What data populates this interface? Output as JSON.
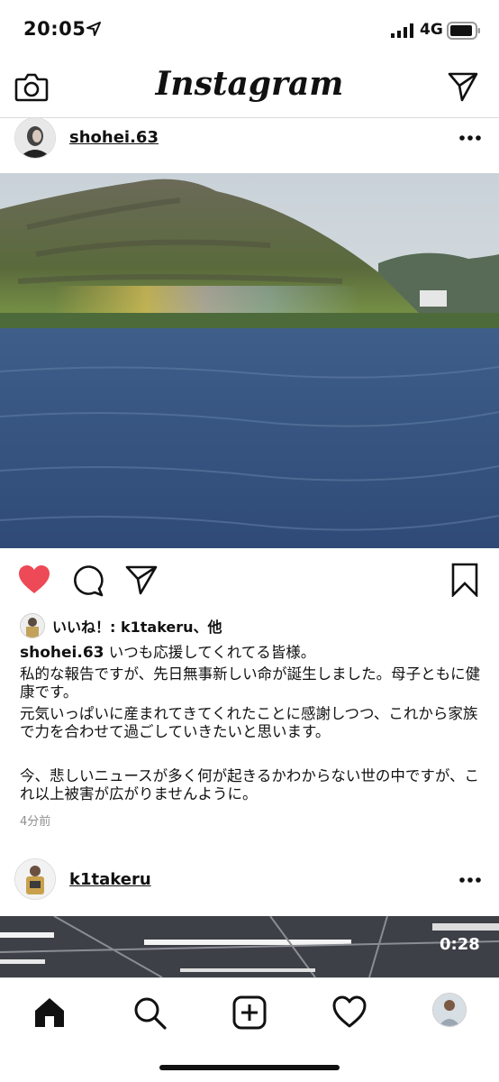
{
  "status_bar": {
    "time": "20:05",
    "network": "4G"
  },
  "nav": {
    "brand": "Instagram"
  },
  "post": {
    "username": "shohei.63",
    "likes_text": "いいね！: k1takeru、他",
    "caption_user": "shohei.63",
    "caption_lines": [
      "いつも応援してくれてる皆様。",
      "私的な報告ですが、先日無事新しい命が誕生しました。母子ともに健康です。",
      "元気いっぱいに産まれてきてくれたことに感謝しつつ、これから家族で力を合わせて過ごしていきたいと思います。",
      "今、悲しいニュースが多く何が起きるかわからない世の中ですが、これ以上被害が広がりませんように。"
    ],
    "timestamp": "4分前"
  },
  "post2": {
    "username": "k1takeru",
    "video_duration": "0:28"
  },
  "colors": {
    "heart": "#ed4956",
    "text": "#111111",
    "muted": "#8e8e8e",
    "divider": "#dbdbdb"
  },
  "icons": [
    "location-arrow-icon",
    "signal-icon",
    "battery-icon",
    "camera-icon",
    "send-icon",
    "more-icon",
    "heart-icon",
    "comment-icon",
    "share-icon",
    "bookmark-icon",
    "home-icon",
    "search-icon",
    "add-post-icon",
    "activity-heart-icon"
  ]
}
